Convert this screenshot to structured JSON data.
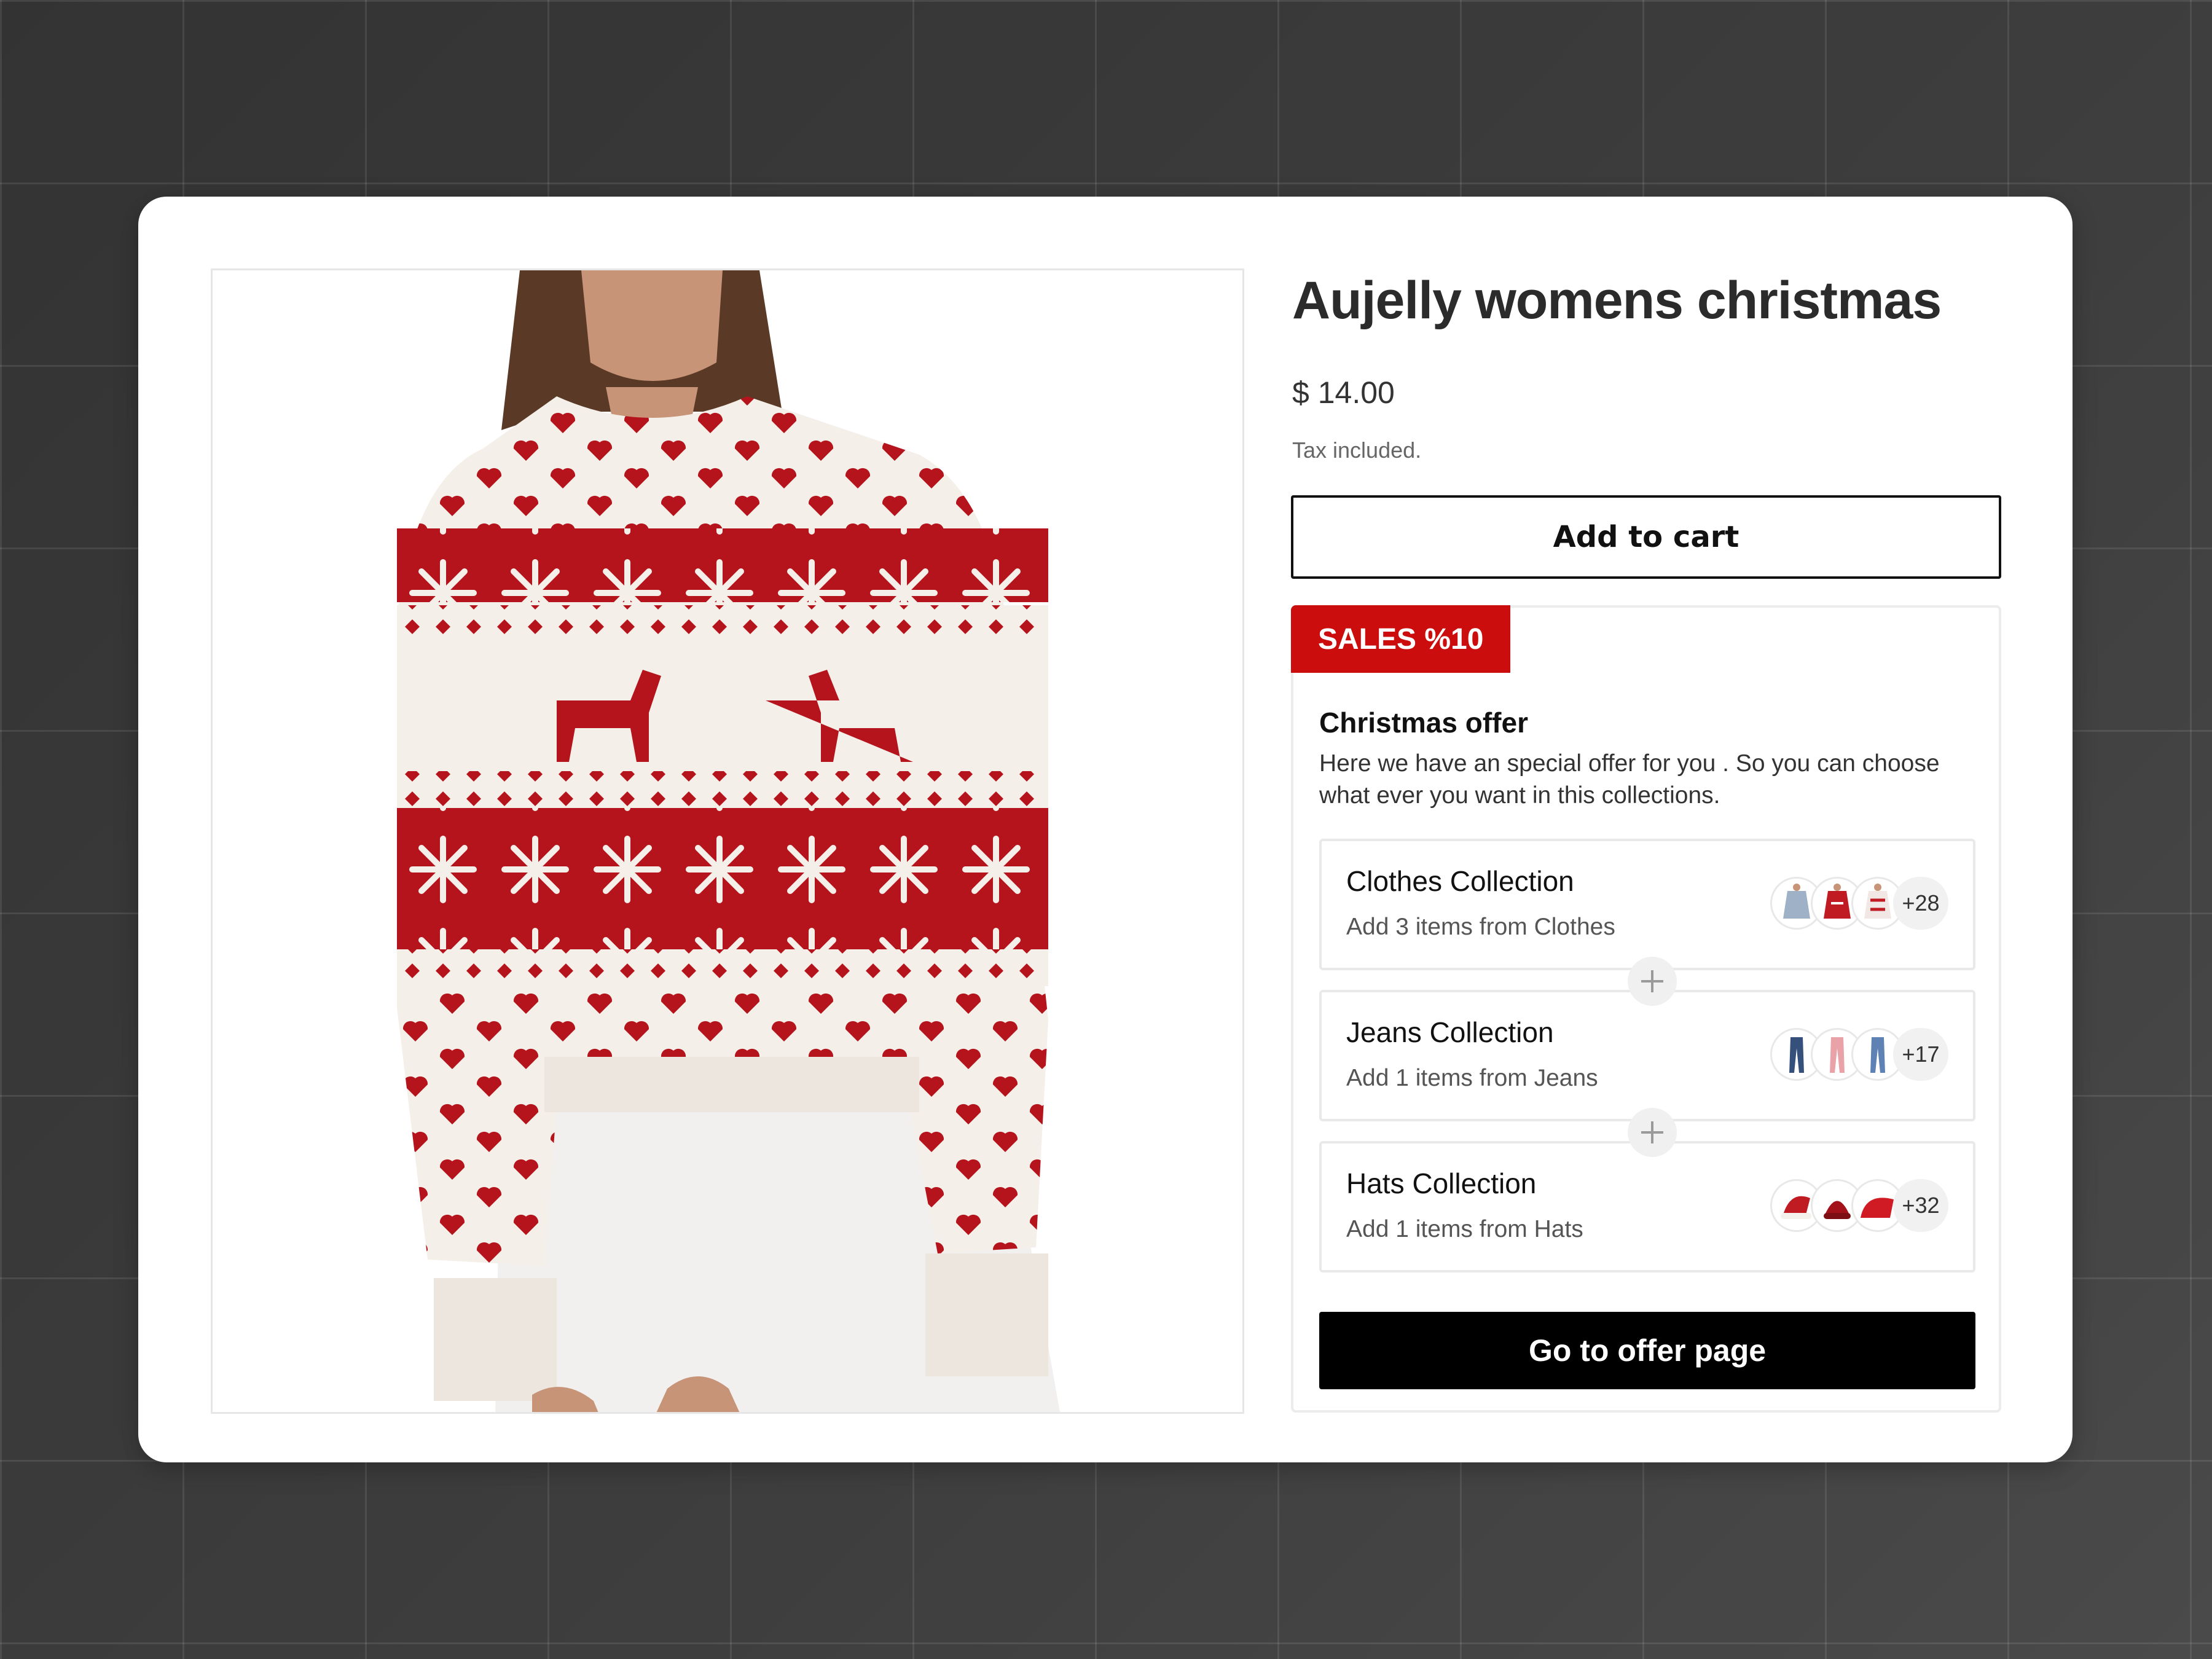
{
  "product": {
    "title": "Aujelly womens christmas",
    "price": "$ 14.00",
    "tax_note": "Tax included.",
    "add_to_cart_label": "Add to cart",
    "image": "red-white-christmas-sweater-photo"
  },
  "offer": {
    "badge": "SALES %10",
    "title": "Christmas offer",
    "description": "Here we have an special offer for you . So you can choose what ever you want in this collections.",
    "collections": [
      {
        "name": "Clothes Collection",
        "subtitle": "Add 3 items from Clothes",
        "more_count": "+28"
      },
      {
        "name": "Jeans Collection",
        "subtitle": "Add 1 items from Jeans",
        "more_count": "+17"
      },
      {
        "name": "Hats Collection",
        "subtitle": "Add 1 items from Hats",
        "more_count": "+32"
      }
    ],
    "cta_label": "Go to offer page"
  },
  "colors": {
    "accent_red": "#cc0d0d",
    "cta_bg": "#000000",
    "background": "#3c3c3c"
  }
}
